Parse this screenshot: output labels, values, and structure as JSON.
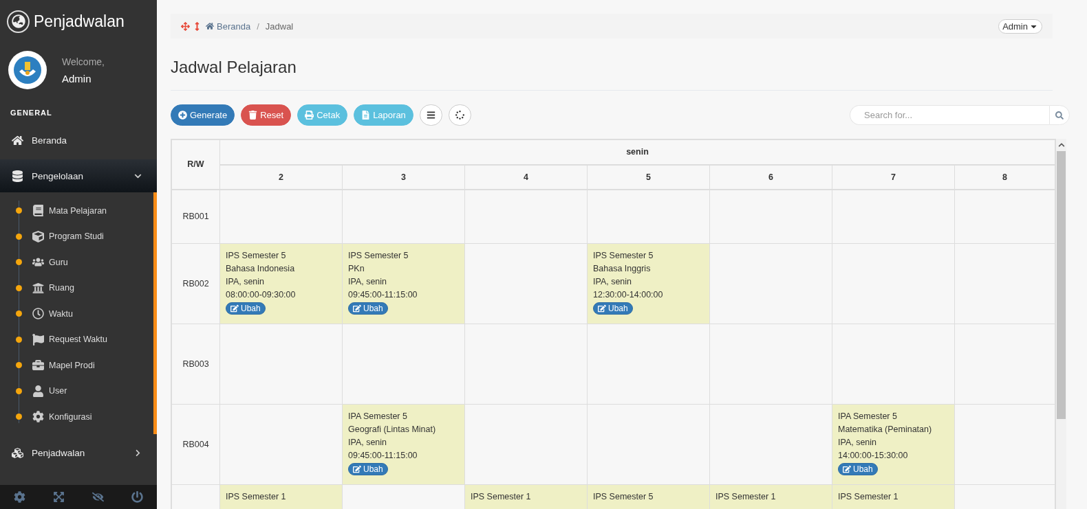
{
  "app": {
    "title": "Penjadwalan"
  },
  "profile": {
    "greeting": "Welcome,",
    "name": "Admin"
  },
  "sidebar": {
    "heading": "GENERAL",
    "items": [
      {
        "label": "Beranda",
        "selected": false
      },
      {
        "label": "Pengelolaan",
        "selected": true,
        "expanded": true,
        "children": [
          {
            "label": "Mata Pelajaran"
          },
          {
            "label": "Program Studi"
          },
          {
            "label": "Guru"
          },
          {
            "label": "Ruang"
          },
          {
            "label": "Waktu"
          },
          {
            "label": "Request Waktu"
          },
          {
            "label": "Mapel Prodi"
          },
          {
            "label": "User"
          },
          {
            "label": "Konfigurasi"
          }
        ]
      },
      {
        "label": "Penjadwalan",
        "selected": false,
        "expanded": false
      }
    ]
  },
  "breadcrumb": [
    "Beranda",
    "Jadwal"
  ],
  "breadcrumb_separator": "/",
  "user_menu": {
    "label": "Admin"
  },
  "page_title": "Jadwal Pelajaran",
  "toolbar": [
    {
      "kind": "generate",
      "label": "Generate"
    },
    {
      "kind": "reset",
      "label": "Reset"
    },
    {
      "kind": "print",
      "label": "Cetak"
    },
    {
      "kind": "report",
      "label": "Laporan"
    },
    {
      "kind": "menu"
    },
    {
      "kind": "loading"
    }
  ],
  "search": {
    "placeholder": "Search for..."
  },
  "table": {
    "corner": "R/W",
    "day": "senin",
    "columns": [
      "2",
      "3",
      "4",
      "5",
      "6",
      "7",
      "8"
    ],
    "rows": [
      {
        "label": "RB001",
        "cells": [
          {},
          {},
          {},
          {},
          {},
          {},
          {}
        ]
      },
      {
        "label": "RB002",
        "cells": [
          {
            "lines": [
              "IPS Semester 5",
              "Bahasa Indonesia",
              "IPA, senin",
              "08:00:00-09:30:00"
            ],
            "button": "Ubah"
          },
          {
            "lines": [
              "IPS Semester 5",
              "PKn",
              "IPA, senin",
              "09:45:00-11:15:00"
            ],
            "button": "Ubah"
          },
          {},
          {
            "lines": [
              "IPS Semester 5",
              "Bahasa Inggris",
              "IPA, senin",
              "12:30:00-14:00:00"
            ],
            "button": "Ubah"
          },
          {},
          {},
          {}
        ]
      },
      {
        "label": "RB003",
        "cells": [
          {},
          {},
          {},
          {},
          {},
          {},
          {}
        ]
      },
      {
        "label": "RB004",
        "cells": [
          {},
          {
            "lines": [
              "IPA Semester 5",
              "Geografi (Lintas Minat)",
              "IPA, senin",
              "09:45:00-11:15:00"
            ],
            "button": "Ubah"
          },
          {},
          {},
          {},
          {
            "lines": [
              "IPA Semester 5",
              "Matematika (Peminatan)",
              "IPA, senin",
              "14:00:00-15:30:00"
            ],
            "button": "Ubah"
          },
          {}
        ]
      },
      {
        "cells": [
          {
            "lines": [
              "IPS Semester 1"
            ]
          },
          {},
          {
            "lines": [
              "IPS Semester 1"
            ]
          },
          {
            "lines": [
              "IPS Semester 5"
            ]
          },
          {
            "lines": [
              "IPS Semester 1"
            ]
          },
          {
            "lines": [
              "IPS Semester 1"
            ]
          },
          {}
        ]
      }
    ]
  }
}
